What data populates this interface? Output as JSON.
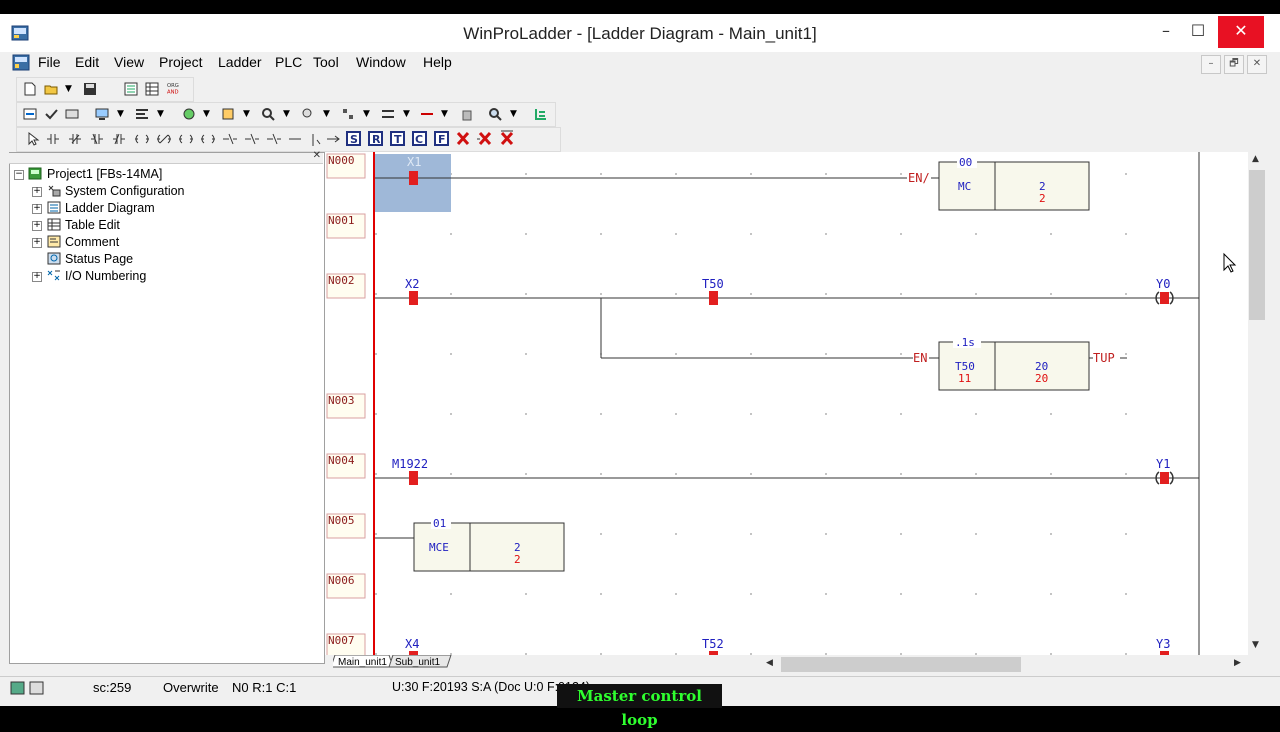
{
  "window": {
    "title": "WinProLadder - [Ladder Diagram - Main_unit1]",
    "minimize_glyph": "–",
    "maximize_glyph": "☐",
    "close_glyph": "✕"
  },
  "menu": [
    "File",
    "Edit",
    "View",
    "Project",
    "Ladder",
    "PLC",
    "Tool",
    "Window",
    "Help"
  ],
  "mdi_controls": [
    "–",
    "🗗",
    "✕"
  ],
  "tree": {
    "root": "Project1 [FBs-14MA]",
    "items": [
      {
        "label": "System Configuration",
        "icon": "system-config-icon",
        "expandable": true
      },
      {
        "label": "Ladder Diagram",
        "icon": "ladder-icon",
        "expandable": true
      },
      {
        "label": "Table Edit",
        "icon": "table-icon",
        "expandable": true
      },
      {
        "label": "Comment",
        "icon": "comment-icon",
        "expandable": true
      },
      {
        "label": "Status Page",
        "icon": "status-page-icon",
        "expandable": false
      },
      {
        "label": "I/O Numbering",
        "icon": "io-numbering-icon",
        "expandable": true
      }
    ]
  },
  "ladder": {
    "networks": [
      "N000",
      "N001",
      "N002",
      "N003",
      "N004",
      "N005",
      "N006",
      "N007"
    ],
    "n000": {
      "contact": "X1",
      "en": "EN/",
      "fb_top": "00",
      "fb_name": "MC",
      "fb_val1": "2",
      "fb_val2": "2"
    },
    "n002": {
      "contact1": "X2",
      "contact2": "T50",
      "coil": "Y0",
      "en": "EN",
      "fb_top": ".1s",
      "fb_name": "T50",
      "fb_sub": "11",
      "fb_val1": "20",
      "fb_val2": "20",
      "out": "TUP"
    },
    "n004": {
      "contact": "M1922",
      "coil": "Y1"
    },
    "n005": {
      "fb_top": "01",
      "fb_name": "MCE",
      "fb_val1": "2",
      "fb_val2": "2"
    },
    "n007": {
      "contact1": "X4",
      "contact2": "T52",
      "coil": "Y3"
    }
  },
  "tabs": [
    "Main_unit1",
    "Sub_unit1"
  ],
  "status": {
    "sc": "sc:259",
    "mode": "Overwrite",
    "pos": "N0 R:1 C:1",
    "info": "U:30 F:20193 S:A (Doc U:0 F:0124)"
  },
  "caption": "Master control loop",
  "colors": {
    "contact_red": "#e21f1f",
    "label_blue": "#2020c0",
    "network_border": "#d9a0a0",
    "power_rail": "#e00000",
    "selection": "#9fb8d8"
  }
}
